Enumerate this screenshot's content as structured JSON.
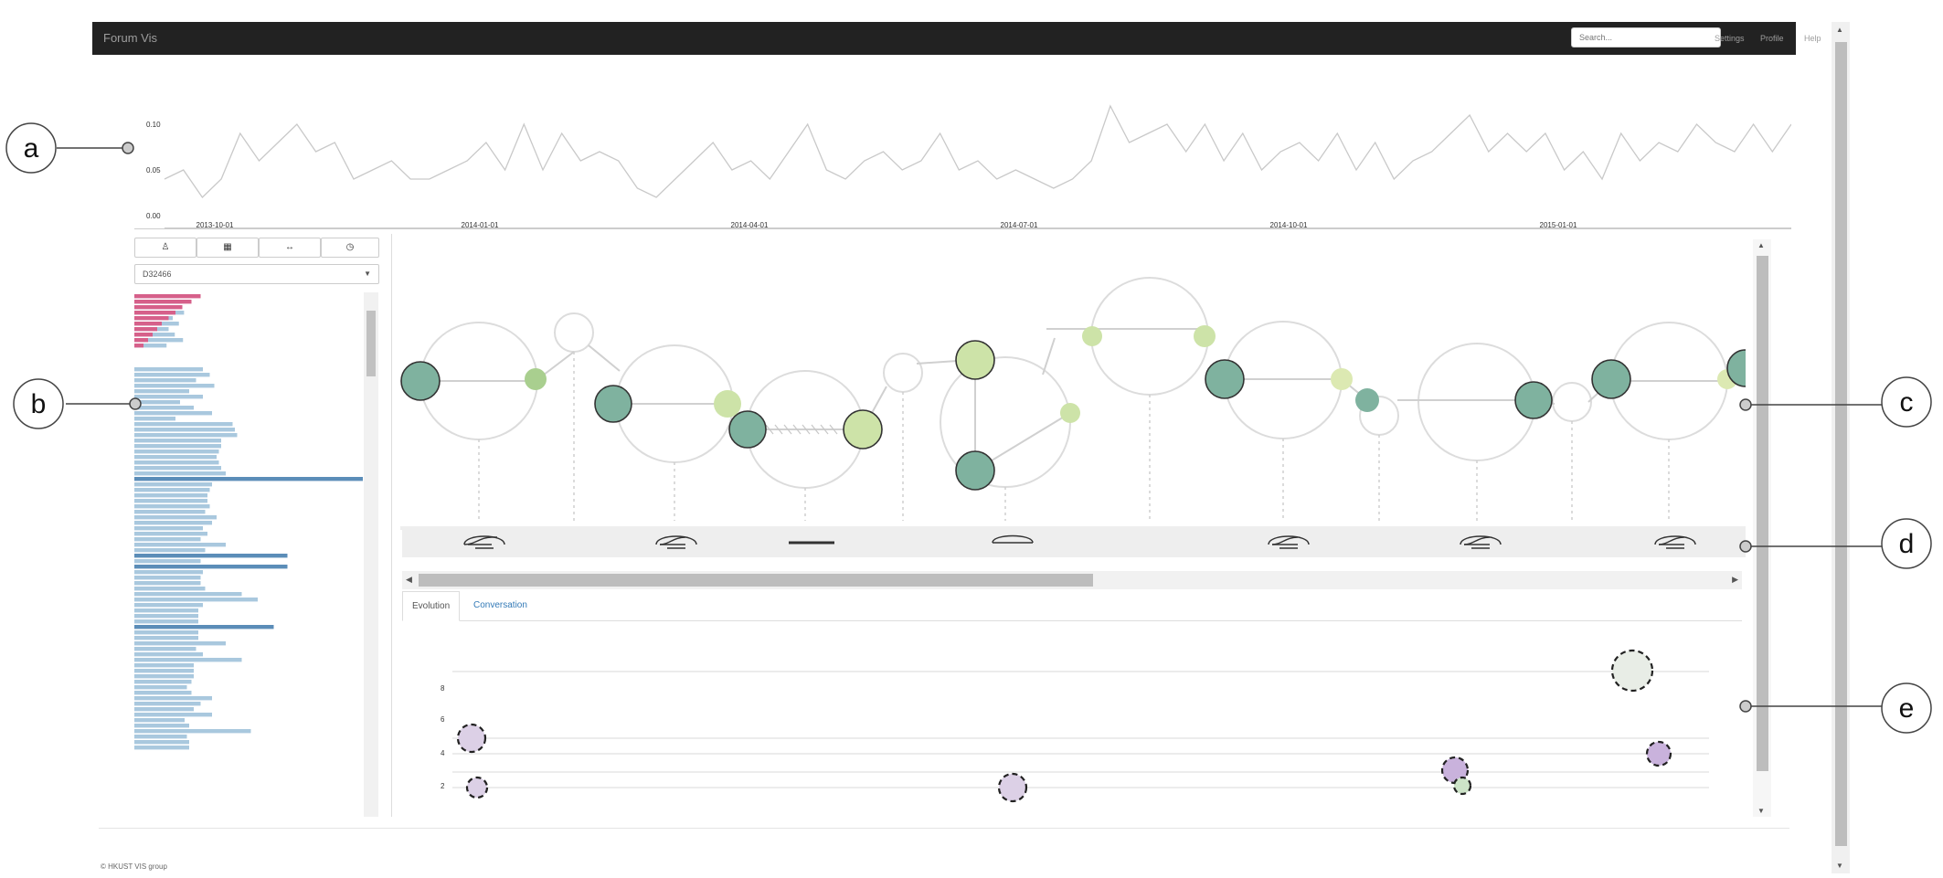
{
  "navbar": {
    "brand": "Forum Vis",
    "search_placeholder": "Search...",
    "links": [
      "Settings",
      "Profile",
      "Help"
    ]
  },
  "timeline": {
    "y_ticks": [
      "0.10",
      "0.05",
      "0.00"
    ],
    "x_ticks": [
      "2013-10-01",
      "2014-01-01",
      "2014-04-01",
      "2014-07-01",
      "2014-10-01",
      "2015-01-01"
    ],
    "series": [
      0.04,
      0.05,
      0.02,
      0.04,
      0.09,
      0.06,
      0.08,
      0.1,
      0.07,
      0.08,
      0.04,
      0.05,
      0.06,
      0.04,
      0.04,
      0.05,
      0.06,
      0.08,
      0.05,
      0.1,
      0.05,
      0.09,
      0.06,
      0.07,
      0.06,
      0.03,
      0.02,
      0.04,
      0.06,
      0.08,
      0.05,
      0.06,
      0.04,
      0.07,
      0.1,
      0.05,
      0.04,
      0.06,
      0.07,
      0.05,
      0.06,
      0.09,
      0.05,
      0.06,
      0.04,
      0.05,
      0.04,
      0.03,
      0.04,
      0.06,
      0.12,
      0.08,
      0.09,
      0.1,
      0.07,
      0.1,
      0.06,
      0.09,
      0.05,
      0.07,
      0.08,
      0.06,
      0.09,
      0.05,
      0.08,
      0.04,
      0.06,
      0.07,
      0.09,
      0.11,
      0.07,
      0.09,
      0.07,
      0.09,
      0.05,
      0.07,
      0.04,
      0.09,
      0.06,
      0.08,
      0.07,
      0.1,
      0.08,
      0.07,
      0.1,
      0.07,
      0.1
    ]
  },
  "controls": {
    "buttons": [
      "user-icon",
      "calendar-icon",
      "arrows-icon",
      "clock-icon"
    ],
    "selected_user": "D32466"
  },
  "user_list": {
    "pink_values": [
      0.29,
      0.25,
      0.21,
      0.18,
      0.15,
      0.12,
      0.1,
      0.08,
      0.06,
      0.04
    ],
    "blue_values": [
      0.3,
      0.33,
      0.27,
      0.35,
      0.24,
      0.3,
      0.2,
      0.26,
      0.34,
      0.18,
      0.43,
      0.44,
      0.45,
      0.38,
      0.38,
      0.37,
      0.36,
      0.37,
      0.38,
      0.4,
      1.0,
      0.34,
      0.33,
      0.32,
      0.32,
      0.33,
      0.31,
      0.36,
      0.34,
      0.3,
      0.32,
      0.29,
      0.4,
      0.31,
      0.67,
      0.29,
      0.67,
      0.3,
      0.29,
      0.29,
      0.31,
      0.47,
      0.54,
      0.3,
      0.28,
      0.28,
      0.28,
      0.61,
      0.28,
      0.28,
      0.4,
      0.27,
      0.3,
      0.47,
      0.26,
      0.26,
      0.26,
      0.25,
      0.23,
      0.25,
      0.34,
      0.29,
      0.26,
      0.34,
      0.22,
      0.24,
      0.51,
      0.23,
      0.24,
      0.24
    ]
  },
  "graph": {
    "lanes_label": "",
    "nodes": "conversation-graph"
  },
  "tabs": [
    "Evolution",
    "Conversation"
  ],
  "evolution": {
    "y_ticks": [
      "8",
      "6",
      "4",
      "2"
    ]
  },
  "footer": {
    "text": "© HKUST VIS group"
  },
  "callouts": [
    "a",
    "b",
    "c",
    "d",
    "e"
  ],
  "colors": {
    "dark_node": "#7fb29f",
    "light_node": "#cde3a8",
    "pink_bar": "#d6608a",
    "blue_bar": "#a9c8de",
    "blue_bar_dark": "#5b8db8",
    "purple_bubble": "#dcd0e6"
  }
}
